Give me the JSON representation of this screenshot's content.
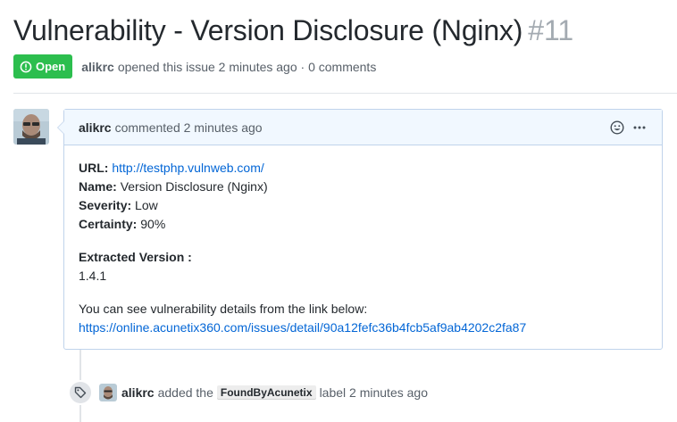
{
  "issue": {
    "title": "Vulnerability - Version Disclosure (Nginx)",
    "number": "#11",
    "state": "Open",
    "author": "alikrc",
    "opened_text": "opened this issue 2 minutes ago · 0 comments"
  },
  "comment": {
    "author": "alikrc",
    "action": "commented 2 minutes ago",
    "fields": [
      {
        "label": "URL:",
        "value": "http://testphp.vulnweb.com/"
      },
      {
        "label": "Name:",
        "value": "Version Disclosure (Nginx)"
      },
      {
        "label": "Severity:",
        "value": "Low"
      },
      {
        "label": "Certainty:",
        "value": "90%"
      }
    ],
    "extracted_label": "Extracted Version :",
    "extracted_value": "1.4.1",
    "details_text": "You can see vulnerability details from the link below:",
    "details_link": "https://online.acunetix360.com/issues/detail/90a12fefc36b4fcb5af9ab4202c2fa87"
  },
  "event": {
    "author": "alikrc",
    "action": "added the",
    "label": "FoundByAcunetix",
    "tail": "label 2 minutes ago"
  },
  "icons": {
    "open": "issue-opened-icon",
    "emoji": "smiley-icon",
    "more": "kebab-horizontal-icon",
    "tag": "tag-icon"
  },
  "colors": {
    "open_badge": "#2cbe4e",
    "link": "#0366d6",
    "comment_header_bg": "#f1f8ff",
    "comment_border": "#c0d3eb"
  }
}
